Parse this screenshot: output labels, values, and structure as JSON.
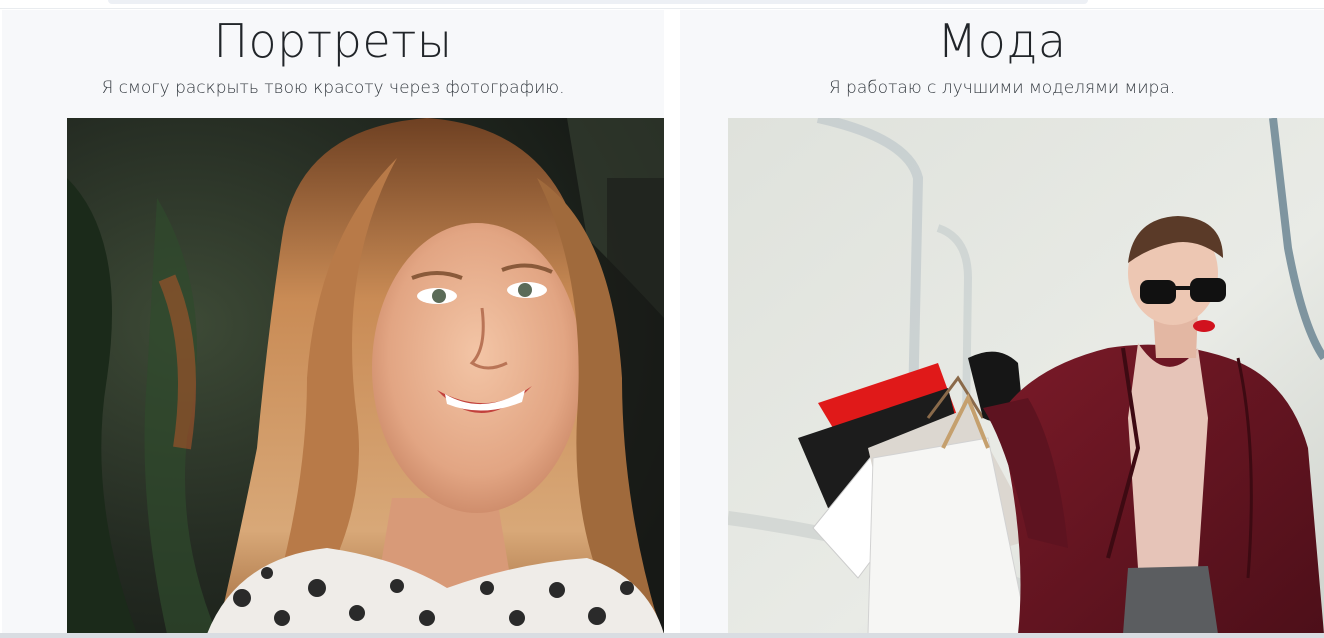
{
  "sections": [
    {
      "title": "Портреты",
      "subtitle": "Я смогу раскрыть твою красоту через фотографию.",
      "image": "portrait-woman-photo"
    },
    {
      "title": "Мода",
      "subtitle": "Я работаю с лучшими моделями мира.",
      "image": "fashion-shopping-woman-photo"
    }
  ],
  "colors": {
    "card_bg": "#f7f8fa",
    "text": "#212529",
    "accent_red": "#e01919",
    "coat": "#6b1422"
  }
}
